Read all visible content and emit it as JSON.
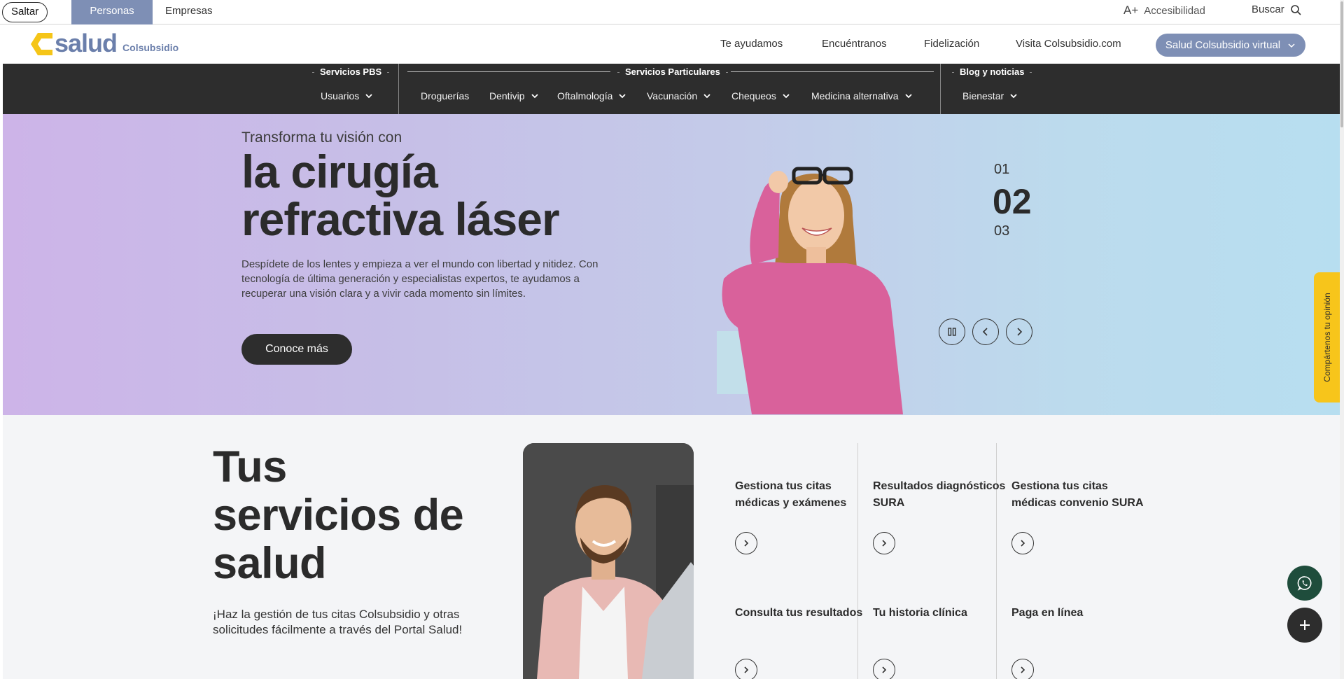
{
  "topbar": {
    "skip_label": "Saltar",
    "tabs": [
      {
        "label": "Personas",
        "active": true
      },
      {
        "label": "Empresas",
        "active": false
      }
    ],
    "accessibility_icon": "A+",
    "accessibility_label": "Accesibilidad",
    "search_label": "Buscar"
  },
  "header": {
    "logo_word": "salud",
    "logo_sub": "Colsubsidio",
    "nav": [
      "Te ayudamos",
      "Encuéntranos",
      "Fidelización",
      "Visita Colsubsidio.com"
    ],
    "virtual_button": "Salud Colsubsidio virtual"
  },
  "services_bar": {
    "groups": [
      {
        "title": "Servicios PBS",
        "items": [
          "Usuarios"
        ]
      },
      {
        "title": "Servicios Particulares",
        "items": [
          "Droguerías",
          "Dentivip",
          "Oftalmología",
          "Vacunación",
          "Chequeos",
          "Medicina alternativa"
        ]
      },
      {
        "title": "Blog y noticias",
        "items": [
          "Bienestar"
        ]
      }
    ]
  },
  "hero": {
    "kicker": "Transforma tu visión con",
    "title_line1": "la cirugía",
    "title_line2": "refractiva láser",
    "description": "Despídete de los lentes y empieza a ver el mundo con libertad y nitidez. Con tecnología de última generación y especialistas expertos, te ayudamos a recuperar una visión clara y a vivir cada momento sin límites.",
    "cta": "Conoce más",
    "slides": [
      "01",
      "02",
      "03"
    ],
    "active_slide": "02"
  },
  "feedback": {
    "label": "Compártenos tu opinión"
  },
  "services": {
    "title_line1": "Tus",
    "title_line2": "servicios de",
    "title_line3": "salud",
    "description": "¡Haz la gestión de tus citas Colsubsidio y otras solicitudes fácilmente a través del Portal Salud!",
    "items": [
      "Gestiona tus citas médicas y exámenes",
      "Resultados diagnósticos SURA",
      "Gestiona tus citas médicas convenio SURA",
      "Consulta tus resultados",
      "Tu historia clínica",
      "Paga en línea"
    ]
  },
  "colors": {
    "accent": "#7e8fb5",
    "dark": "#2d2d2d",
    "logo_yellow": "#f5c518",
    "feedback_yellow": "#f7c51b",
    "whatsapp_green": "#1f4d3c"
  }
}
